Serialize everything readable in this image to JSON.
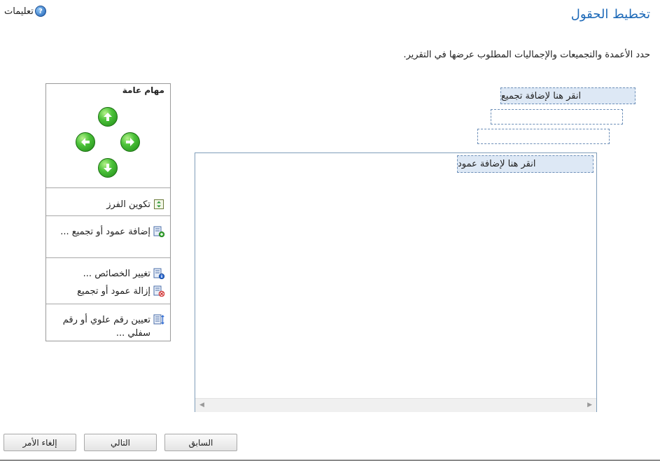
{
  "header": {
    "title": "تخطيط الحقول",
    "help_label": "تعليمات",
    "help_glyph": "?"
  },
  "instruction": "حدد الأعمدة والتجميعات والإجماليات المطلوب عرضها في التقرير.",
  "layout": {
    "add_total_label": "انقر هنا لإضافة تجميع",
    "add_column_label": "انقر هنا لإضافة عمود"
  },
  "tasks": {
    "title": "مهام عامة",
    "sort": "تكوين الفرز",
    "add_column_or_group": "إضافة عمود أو تجميع ...",
    "change_properties": "تغيير الخصائص ...",
    "remove_column_or_group": "إزالة عمود أو تجميع",
    "set_superscript_subscript": "تعيين رقم علوي أو رقم سفلي ..."
  },
  "buttons": {
    "previous": "السابق",
    "next": "التالي",
    "cancel": "إلغاء الأمر"
  },
  "colors": {
    "title": "#1e6ab8",
    "drop_fill": "#dde8f5",
    "drop_border": "#6d8fb8",
    "arrow_green": "#4cc23a"
  }
}
